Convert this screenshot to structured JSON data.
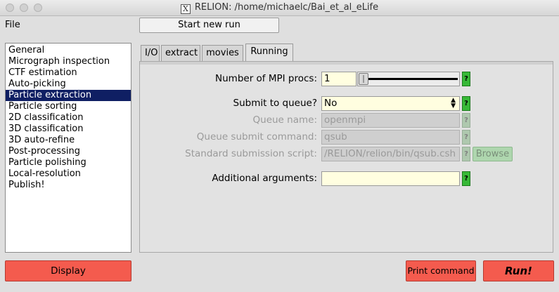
{
  "window": {
    "title": "RELION: /home/michaelc/Bai_et_al_eLife",
    "x_icon_glyph": "X"
  },
  "menu": {
    "file_label": "File"
  },
  "toolbar": {
    "start_new_run": "Start new run"
  },
  "job_list": {
    "selected_index": 4,
    "items": [
      "General",
      "Micrograph inspection",
      "CTF estimation",
      "Auto-picking",
      "Particle extraction",
      "Particle sorting",
      "2D classification",
      "3D classification",
      "3D auto-refine",
      "Post-processing",
      "Particle polishing",
      "Local-resolution",
      "Publish!"
    ]
  },
  "tabs": [
    "I/O",
    "extract",
    "movies",
    "Running"
  ],
  "active_tab": "Running",
  "form": {
    "mpi": {
      "label": "Number of MPI procs:",
      "value": "1",
      "help": "?"
    },
    "queue": {
      "label": "Submit to queue?",
      "value": "No",
      "help": "?"
    },
    "queue_name": {
      "label": "Queue name:",
      "value": "openmpi",
      "help": "?"
    },
    "queue_cmd": {
      "label": "Queue submit command:",
      "value": "qsub",
      "help": "?"
    },
    "script": {
      "label": "Standard submission script:",
      "value": "/RELION/relion/bin/qsub.csh",
      "help": "?",
      "browse": "Browse"
    },
    "args": {
      "label": "Additional arguments:",
      "value": "",
      "help": "?"
    }
  },
  "buttons": {
    "display": "Display",
    "print_command": "Print command",
    "run": "Run!"
  },
  "colors": {
    "selected_bg": "#0f1f63",
    "input_bg": "#fffee0",
    "help_green": "#37b837",
    "red_button": "#f45b4e"
  },
  "icons": {
    "select_arrows": "select-arrows-icon"
  }
}
